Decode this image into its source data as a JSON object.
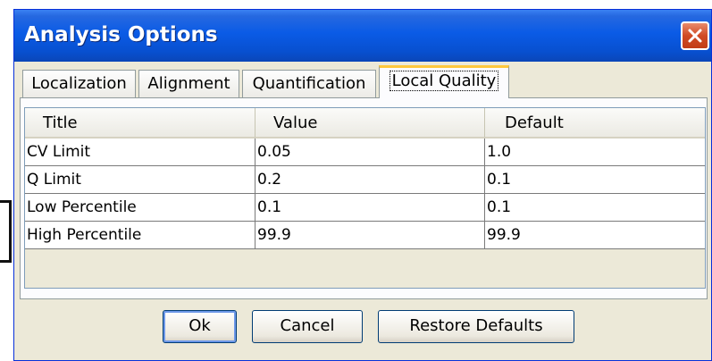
{
  "window": {
    "title": "Analysis Options"
  },
  "tabs": [
    {
      "label": "Localization",
      "active": false
    },
    {
      "label": "Alignment",
      "active": false
    },
    {
      "label": "Quantification",
      "active": false
    },
    {
      "label": "Local Quality",
      "active": true
    }
  ],
  "table": {
    "columns": [
      "Title",
      "Value",
      "Default"
    ],
    "rows": [
      [
        "CV Limit",
        "0.05",
        "1.0"
      ],
      [
        "Q Limit",
        "0.2",
        "0.1"
      ],
      [
        "Low Percentile",
        "0.1",
        "0.1"
      ],
      [
        "High Percentile",
        "99.9",
        "99.9"
      ]
    ]
  },
  "buttons": {
    "ok": "Ok",
    "cancel": "Cancel",
    "restore": "Restore Defaults"
  },
  "icons": {
    "close": "close-icon"
  },
  "colors": {
    "titlebar": "#0a5be6",
    "close_button": "#d04a24",
    "dialog_bg": "#ece9d8",
    "active_tab_accent": "#ffc83c"
  }
}
